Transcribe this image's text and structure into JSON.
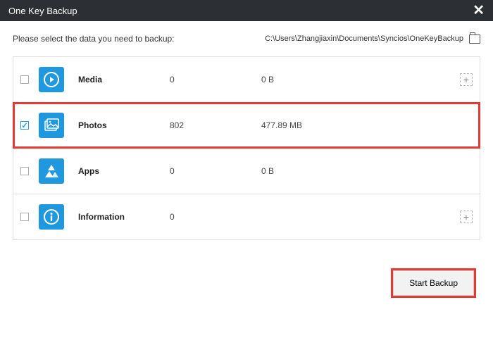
{
  "window": {
    "title": "One Key Backup"
  },
  "instruction": "Please select the data you need to backup:",
  "backup_path": "C:\\Users\\Zhangjiaxin\\Documents\\Syncios\\OneKeyBackup",
  "items": [
    {
      "label": "Media",
      "count": "0",
      "size": "0 B",
      "checked": false,
      "highlighted": false,
      "expandable": true,
      "icon": "media"
    },
    {
      "label": "Photos",
      "count": "802",
      "size": "477.89 MB",
      "checked": true,
      "highlighted": true,
      "expandable": false,
      "icon": "photos"
    },
    {
      "label": "Apps",
      "count": "0",
      "size": "0 B",
      "checked": false,
      "highlighted": false,
      "expandable": false,
      "icon": "apps"
    },
    {
      "label": "Information",
      "count": "0",
      "size": "",
      "checked": false,
      "highlighted": false,
      "expandable": true,
      "icon": "info"
    }
  ],
  "buttons": {
    "start": "Start Backup"
  }
}
